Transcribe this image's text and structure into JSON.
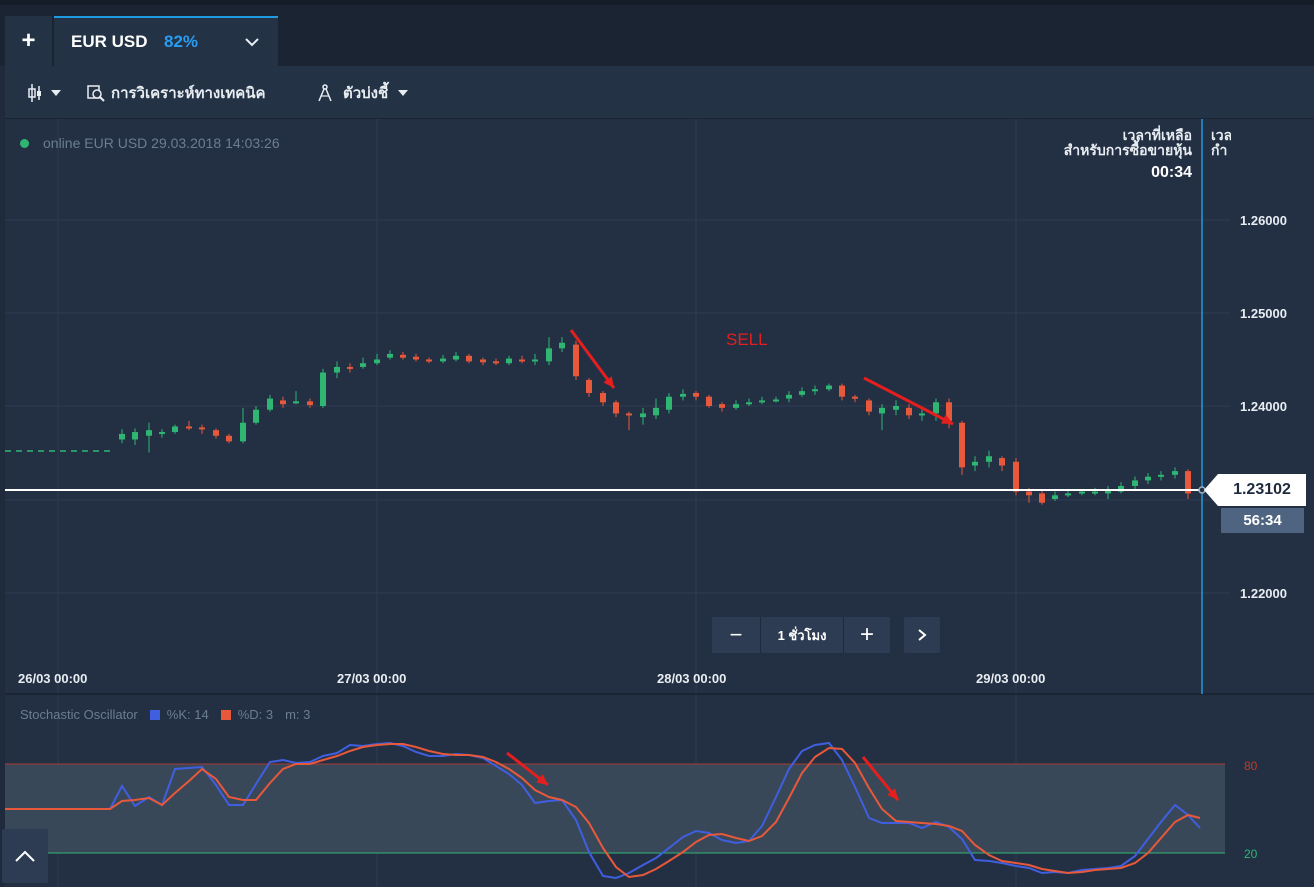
{
  "tabs": {
    "new_tab_symbol": "+",
    "asset_name": "EUR USD",
    "asset_payout": "82%"
  },
  "toolbar": {
    "technical_analysis_label": "การวิเคราะห์ทางเทคนิค",
    "indicators_label": "ตัวบ่งชี้"
  },
  "status": {
    "text": "online EUR USD 29.03.2018 14:03:26",
    "online_color": "#2fb673"
  },
  "timer": {
    "title_line1": "เวลาที่เหลือ",
    "title_line2": "สำหรับการซื้อขายหุ้น",
    "value": "00:34",
    "next_title_line1": "เวล",
    "next_title_line2": "กำ"
  },
  "price_axis": {
    "labels": [
      "1.26000",
      "1.25000",
      "1.24000",
      "1.22000"
    ]
  },
  "current": {
    "price": "1.23102",
    "countdown": "56:34"
  },
  "date_axis": {
    "labels": [
      "26/03 00:00",
      "27/03 00:00",
      "28/03 00:00",
      "29/03 00:00"
    ]
  },
  "zoom": {
    "minus": "−",
    "label": "1 ชั่วโมง",
    "plus": "+",
    "next": "›"
  },
  "annotation": {
    "sell_text": "SELL",
    "color": "#e51e1e"
  },
  "oscillator": {
    "name": "Stochastic Oscillator",
    "k_label": "%K: 14",
    "d_label": "%D: 3",
    "m_label": "m: 3",
    "k_color": "#3f5fe0",
    "d_color": "#e8583a",
    "upper": "80",
    "lower": "20"
  },
  "colors": {
    "up_candle": "#2fb673",
    "down_candle": "#e8583a",
    "accent": "#1e9be0"
  }
}
